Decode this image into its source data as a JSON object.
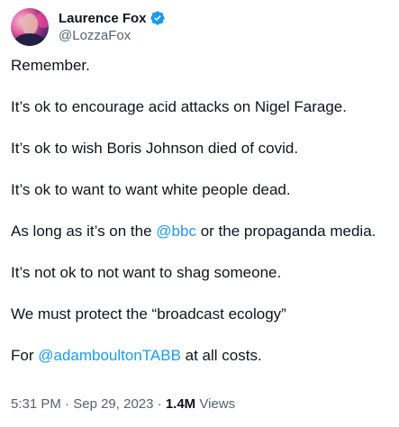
{
  "author": {
    "display_name": "Laurence Fox",
    "handle": "@LozzaFox",
    "verified_icon": "verified-badge-icon",
    "verified_color": "#1d9bf0"
  },
  "tweet": {
    "line1": "Remember.",
    "line2": "It’s ok to encourage acid attacks on Nigel Farage.",
    "line3": "It’s ok to wish Boris Johnson died of covid.",
    "line4": "It’s ok to want to want white people dead.",
    "line5_before": "As long as it’s on the ",
    "line5_mention": "@bbc",
    "line5_after": " or the propaganda media.",
    "line6": "It’s not ok to not want to shag someone.",
    "line7": "We must protect the “broadcast ecology”",
    "line8_before": "For ",
    "line8_mention": "@adamboultonTABB",
    "line8_after": " at all costs."
  },
  "meta": {
    "time": "5:31 PM",
    "separator1": " · ",
    "date": "Sep 29, 2023",
    "separator2": " · ",
    "views_count": "1.4M",
    "views_label": " Views"
  },
  "colors": {
    "text": "#0f1419",
    "secondary": "#536471",
    "link": "#1d9bf0"
  }
}
